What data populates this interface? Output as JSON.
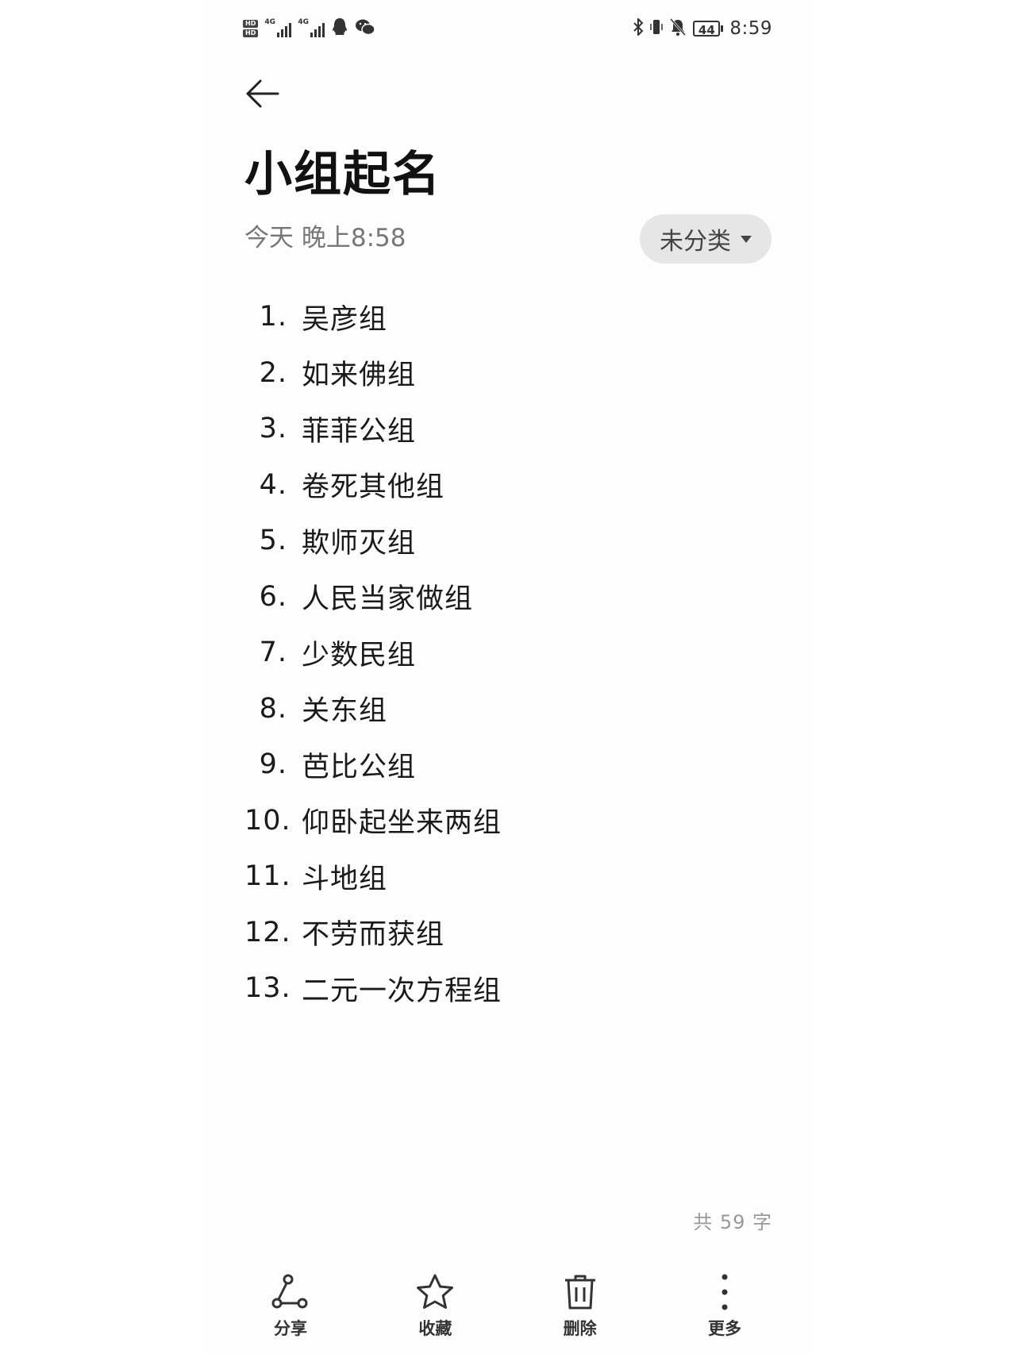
{
  "status_bar": {
    "hd_badges": [
      "HD",
      "HD"
    ],
    "network_1": "4G",
    "network_2": "4G",
    "battery": "44",
    "time": "8:59"
  },
  "note": {
    "title": "小组起名",
    "timestamp": "今天 晚上8:58",
    "category": "未分类",
    "items": [
      {
        "num": "1.",
        "text": "吴彦组"
      },
      {
        "num": "2.",
        "text": "如来佛组"
      },
      {
        "num": "3.",
        "text": "菲菲公组"
      },
      {
        "num": "4.",
        "text": "卷死其他组"
      },
      {
        "num": "5.",
        "text": "欺师灭组"
      },
      {
        "num": "6.",
        "text": "人民当家做组"
      },
      {
        "num": "7.",
        "text": "少数民组"
      },
      {
        "num": "8.",
        "text": "关东组"
      },
      {
        "num": "9.",
        "text": "芭比公组"
      },
      {
        "num": "10.",
        "text": "仰卧起坐来两组"
      },
      {
        "num": "11.",
        "text": "斗地组"
      },
      {
        "num": "12.",
        "text": "不劳而获组"
      },
      {
        "num": "13.",
        "text": "二元一次方程组"
      }
    ],
    "word_count": "共 59 字"
  },
  "toolbar": {
    "share": {
      "label": "分享",
      "icon": "share-icon"
    },
    "favorite": {
      "label": "收藏",
      "icon": "star-icon"
    },
    "delete": {
      "label": "删除",
      "icon": "trash-icon"
    },
    "more": {
      "label": "更多",
      "icon": "more-vertical-icon"
    }
  }
}
